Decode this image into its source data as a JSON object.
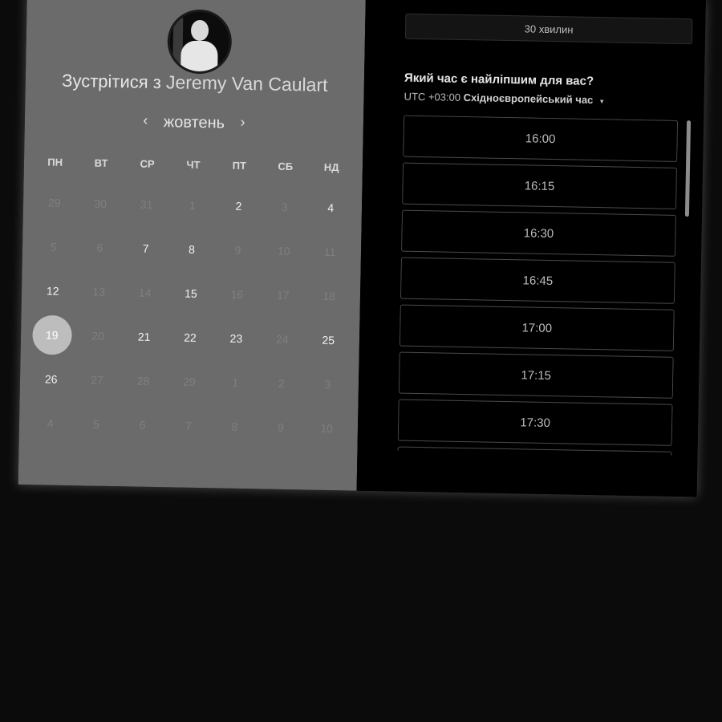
{
  "host": {
    "title_prefix": "Зустрітися з",
    "name": "Jeremy Van Caulart"
  },
  "calendar": {
    "month": "жовтень",
    "prev_icon": "chevron-left-icon",
    "next_icon": "chevron-right-icon",
    "prev_glyph": "‹",
    "next_glyph": "›",
    "weekdays": [
      "ПН",
      "ВТ",
      "СР",
      "ЧТ",
      "ПТ",
      "СБ",
      "НД"
    ],
    "days": [
      {
        "label": "29",
        "state": "muted"
      },
      {
        "label": "30",
        "state": "muted"
      },
      {
        "label": "31",
        "state": "muted"
      },
      {
        "label": "1",
        "state": "muted"
      },
      {
        "label": "2",
        "state": "avail"
      },
      {
        "label": "3",
        "state": "muted"
      },
      {
        "label": "4",
        "state": "avail"
      },
      {
        "label": "5",
        "state": "muted"
      },
      {
        "label": "6",
        "state": "muted"
      },
      {
        "label": "7",
        "state": "avail"
      },
      {
        "label": "8",
        "state": "avail"
      },
      {
        "label": "9",
        "state": "muted"
      },
      {
        "label": "10",
        "state": "muted"
      },
      {
        "label": "11",
        "state": "muted"
      },
      {
        "label": "12",
        "state": "avail"
      },
      {
        "label": "13",
        "state": "muted"
      },
      {
        "label": "14",
        "state": "muted"
      },
      {
        "label": "15",
        "state": "avail"
      },
      {
        "label": "16",
        "state": "muted"
      },
      {
        "label": "17",
        "state": "muted"
      },
      {
        "label": "18",
        "state": "muted"
      },
      {
        "label": "19",
        "state": "selected"
      },
      {
        "label": "20",
        "state": "muted"
      },
      {
        "label": "21",
        "state": "avail"
      },
      {
        "label": "22",
        "state": "avail"
      },
      {
        "label": "23",
        "state": "avail"
      },
      {
        "label": "24",
        "state": "muted"
      },
      {
        "label": "25",
        "state": "avail"
      },
      {
        "label": "26",
        "state": "avail"
      },
      {
        "label": "27",
        "state": "muted"
      },
      {
        "label": "28",
        "state": "muted"
      },
      {
        "label": "29",
        "state": "muted"
      },
      {
        "label": "1",
        "state": "muted"
      },
      {
        "label": "2",
        "state": "muted"
      },
      {
        "label": "3",
        "state": "muted"
      },
      {
        "label": "4",
        "state": "muted"
      },
      {
        "label": "5",
        "state": "muted"
      },
      {
        "label": "6",
        "state": "muted"
      },
      {
        "label": "7",
        "state": "muted"
      },
      {
        "label": "8",
        "state": "muted"
      },
      {
        "label": "9",
        "state": "muted"
      },
      {
        "label": "10",
        "state": "muted"
      }
    ]
  },
  "booking": {
    "duration": "30 хвилин",
    "question": "Який час є найліпшим для вас?",
    "tz_offset": "UTC +03:00",
    "tz_name": "Східноєвропейський час",
    "tz_caret": "▾",
    "slots": [
      "16:00",
      "16:15",
      "16:30",
      "16:45",
      "17:00",
      "17:15",
      "17:30",
      ""
    ]
  },
  "colors": {
    "left_panel": "#6b6b6b",
    "right_panel": "#000000",
    "selected_day": "#bdbdbd"
  }
}
